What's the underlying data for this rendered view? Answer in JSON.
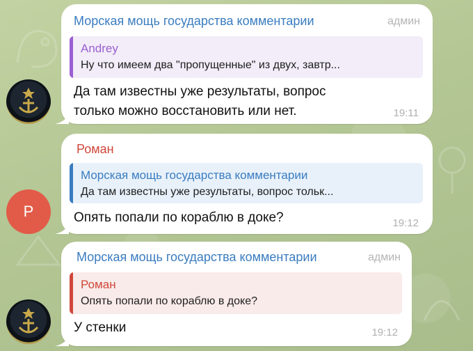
{
  "messages": [
    {
      "sender": "Морская мощь государства комментарии",
      "role": "админ",
      "reply": {
        "name": "Andrey",
        "text": "Ну что имеем два \"пропущенные\" из двух, завтр..."
      },
      "text_lines": [
        "Да там известны уже результаты, вопрос",
        "только можно восстановить или нет."
      ],
      "time": "19:11",
      "avatar": "anchor-emblem"
    },
    {
      "sender": "Роман",
      "role": "",
      "reply": {
        "name": "Морская мощь государства комментарии",
        "text": "Да там известны уже результаты, вопрос тольк..."
      },
      "text_lines": [
        "Опять попали по кораблю в доке?"
      ],
      "time": "19:12",
      "avatar": "Р"
    },
    {
      "sender": "Морская мощь государства комментарии",
      "role": "админ",
      "reply": {
        "name": "Роман",
        "text": "Опять попали по кораблю в доке?"
      },
      "text_lines": [
        "У стенки"
      ],
      "time": "19:12",
      "avatar": "anchor-emblem"
    }
  ],
  "colors": {
    "admin_name": "#3a7cc0",
    "user_name": "#d0473b",
    "reply_andrey": "#9b5fd2",
    "avatar_r": "#e25b48"
  }
}
